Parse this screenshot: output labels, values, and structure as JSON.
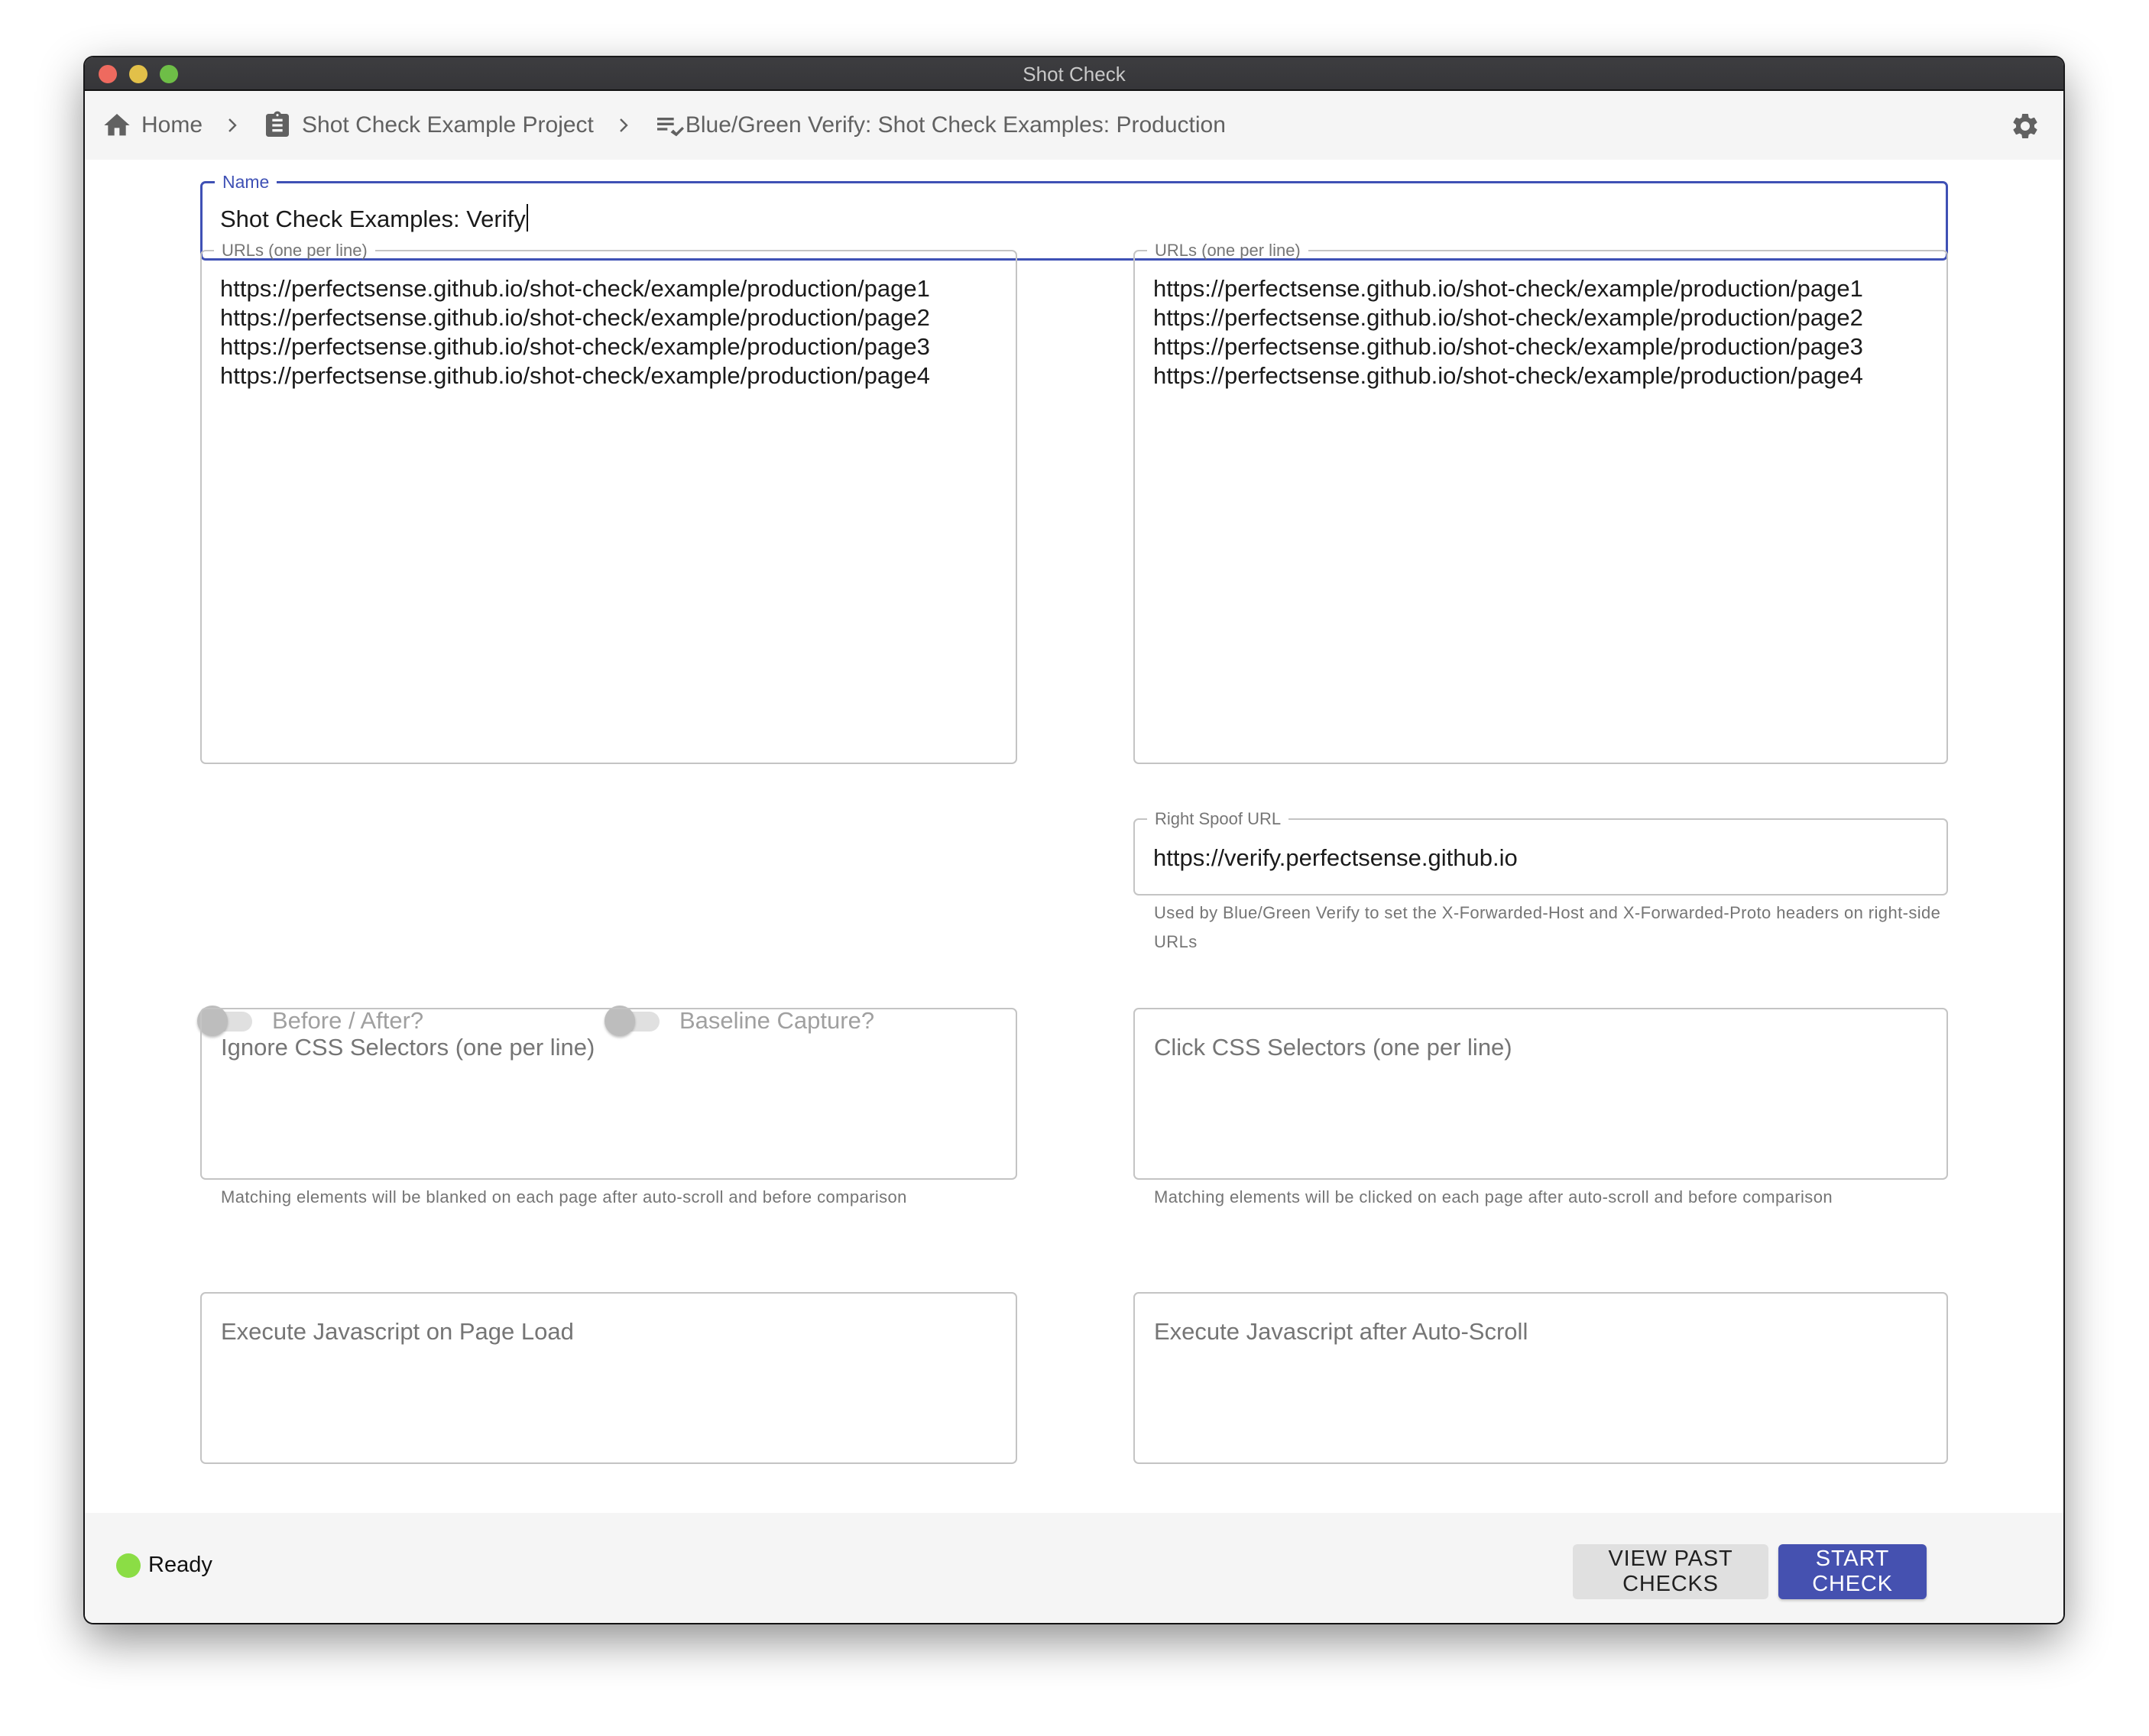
{
  "window": {
    "title": "Shot Check"
  },
  "breadcrumb": {
    "items": [
      {
        "label": "Home",
        "icon": "home-icon"
      },
      {
        "label": "Shot Check Example Project",
        "icon": "clipboard-icon"
      },
      {
        "label": "Blue/Green Verify: Shot Check Examples: Production",
        "icon": "checklist-icon"
      }
    ],
    "separator_icon": "chevron-right-icon",
    "settings_icon": "gear-icon"
  },
  "form": {
    "name": {
      "label": "Name",
      "value": "Shot Check Examples: Verify"
    },
    "left_urls": {
      "label": "URLs (one per line)",
      "value": "https://perfectsense.github.io/shot-check/example/production/page1\nhttps://perfectsense.github.io/shot-check/example/production/page2\nhttps://perfectsense.github.io/shot-check/example/production/page3\nhttps://perfectsense.github.io/shot-check/example/production/page4"
    },
    "right_urls": {
      "label": "URLs (one per line)",
      "value": "https://perfectsense.github.io/shot-check/example/production/page1\nhttps://perfectsense.github.io/shot-check/example/production/page2\nhttps://perfectsense.github.io/shot-check/example/production/page3\nhttps://perfectsense.github.io/shot-check/example/production/page4"
    },
    "toggles": {
      "before_after": {
        "label": "Before / After?",
        "checked": false,
        "disabled": true
      },
      "baseline_capture": {
        "label": "Baseline Capture?",
        "checked": false,
        "disabled": true
      }
    },
    "right_spoof_url": {
      "label": "Right Spoof URL",
      "value": "https://verify.perfectsense.github.io",
      "helper": "Used by Blue/Green Verify to set the X-Forwarded-Host and X-Forwarded-Proto headers on right-side URLs"
    },
    "ignore_selectors": {
      "placeholder": "Ignore CSS Selectors (one per line)",
      "value": "",
      "helper": "Matching elements will be blanked on each page after auto-scroll and before comparison"
    },
    "click_selectors": {
      "placeholder": "Click CSS Selectors (one per line)",
      "value": "",
      "helper": "Matching elements will be clicked on each page after auto-scroll and before comparison"
    },
    "js_page_load": {
      "placeholder": "Execute Javascript on Page Load",
      "value": ""
    },
    "js_after_scroll": {
      "placeholder": "Execute Javascript after Auto-Scroll",
      "value": ""
    }
  },
  "footer": {
    "status": {
      "label": "Ready",
      "color": "#8bdd45"
    },
    "view_past_label": "View Past Checks",
    "start_label": "Start Check"
  },
  "theme": {
    "primary": "#3f51b5",
    "primary_button": "#4551b0"
  }
}
